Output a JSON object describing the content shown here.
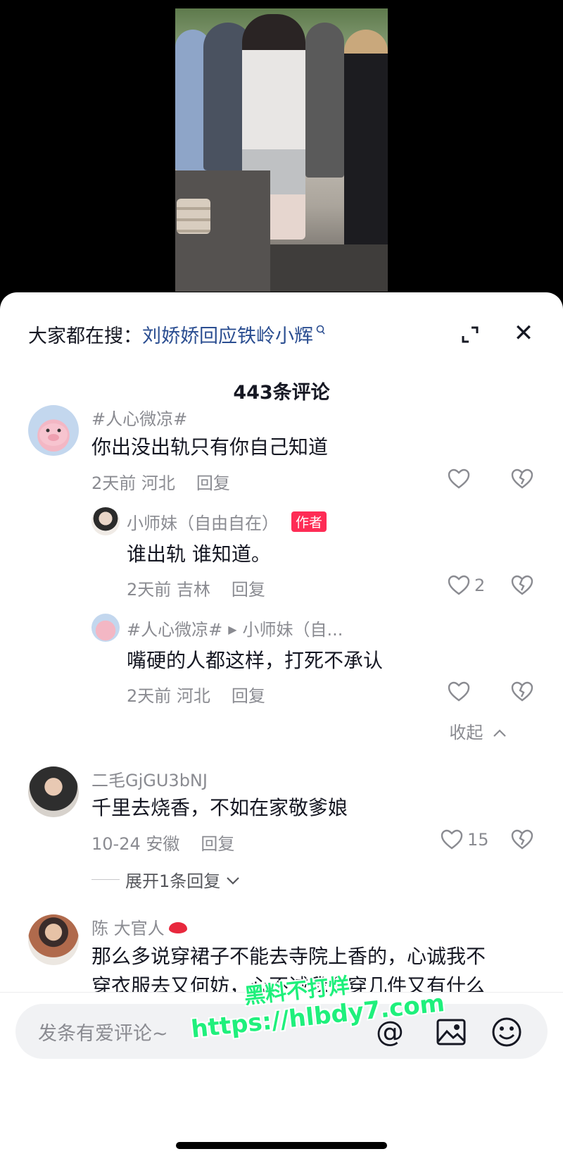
{
  "search": {
    "prefix": "大家都在搜：",
    "term": "刘娇娇回应铁岭小辉"
  },
  "comment_count": "443条评论",
  "comments": [
    {
      "user": "#人心微凉#",
      "text": "你出没出轨只有你自己知道",
      "meta": "2天前 河北",
      "reply_label": "回复",
      "likes": "",
      "replies": [
        {
          "user": "小师妹（自由自在）",
          "tag": "作者",
          "text": "谁出轨 谁知道。",
          "meta": "2天前 吉林",
          "reply_label": "回复",
          "likes": "2"
        },
        {
          "user": "#人心微凉#",
          "reply_to": "小师妹（自...",
          "text": "嘴硬的人都这样，打死不承认",
          "meta": "2天前 河北",
          "reply_label": "回复",
          "likes": ""
        }
      ],
      "collapse_label": "收起"
    },
    {
      "user": "二毛GjGU3bNJ",
      "text": "千里去烧香，不如在家敬爹娘",
      "meta": "10-24 安徽",
      "reply_label": "回复",
      "likes": "15",
      "expand_label": "展开1条回复"
    },
    {
      "user": "陈 大官人",
      "text_line1": "那么多说穿裙子不能去寺院上香的，心诚我不",
      "text_line2": "穿衣服去又何妨，心不诚我多穿几件又有什么"
    }
  ],
  "input": {
    "placeholder": "发条有爱评论~"
  },
  "watermark": {
    "line1": "黑料不打烊",
    "line2": "https://hlbdy7.com"
  },
  "colors": {
    "accent_link": "#2b4e91",
    "author_tag": "#fe2c55",
    "watermark": "#1ff07c"
  },
  "icons": [
    "search-icon",
    "expand-icon",
    "close-icon",
    "heart-icon",
    "broken-heart-icon",
    "chevron-up-icon",
    "chevron-down-icon",
    "at-icon",
    "image-icon",
    "emoji-icon"
  ]
}
